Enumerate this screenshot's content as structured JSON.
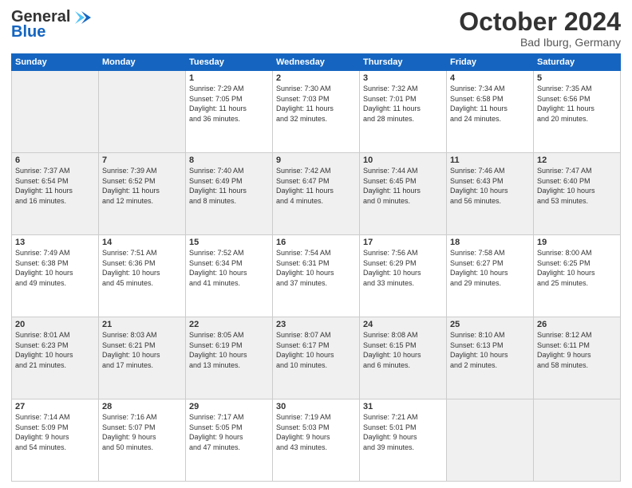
{
  "header": {
    "logo_line1": "General",
    "logo_line2": "Blue",
    "month": "October 2024",
    "location": "Bad Iburg, Germany"
  },
  "days_of_week": [
    "Sunday",
    "Monday",
    "Tuesday",
    "Wednesday",
    "Thursday",
    "Friday",
    "Saturday"
  ],
  "weeks": [
    [
      {
        "day": "",
        "info": ""
      },
      {
        "day": "",
        "info": ""
      },
      {
        "day": "1",
        "info": "Sunrise: 7:29 AM\nSunset: 7:05 PM\nDaylight: 11 hours\nand 36 minutes."
      },
      {
        "day": "2",
        "info": "Sunrise: 7:30 AM\nSunset: 7:03 PM\nDaylight: 11 hours\nand 32 minutes."
      },
      {
        "day": "3",
        "info": "Sunrise: 7:32 AM\nSunset: 7:01 PM\nDaylight: 11 hours\nand 28 minutes."
      },
      {
        "day": "4",
        "info": "Sunrise: 7:34 AM\nSunset: 6:58 PM\nDaylight: 11 hours\nand 24 minutes."
      },
      {
        "day": "5",
        "info": "Sunrise: 7:35 AM\nSunset: 6:56 PM\nDaylight: 11 hours\nand 20 minutes."
      }
    ],
    [
      {
        "day": "6",
        "info": "Sunrise: 7:37 AM\nSunset: 6:54 PM\nDaylight: 11 hours\nand 16 minutes."
      },
      {
        "day": "7",
        "info": "Sunrise: 7:39 AM\nSunset: 6:52 PM\nDaylight: 11 hours\nand 12 minutes."
      },
      {
        "day": "8",
        "info": "Sunrise: 7:40 AM\nSunset: 6:49 PM\nDaylight: 11 hours\nand 8 minutes."
      },
      {
        "day": "9",
        "info": "Sunrise: 7:42 AM\nSunset: 6:47 PM\nDaylight: 11 hours\nand 4 minutes."
      },
      {
        "day": "10",
        "info": "Sunrise: 7:44 AM\nSunset: 6:45 PM\nDaylight: 11 hours\nand 0 minutes."
      },
      {
        "day": "11",
        "info": "Sunrise: 7:46 AM\nSunset: 6:43 PM\nDaylight: 10 hours\nand 56 minutes."
      },
      {
        "day": "12",
        "info": "Sunrise: 7:47 AM\nSunset: 6:40 PM\nDaylight: 10 hours\nand 53 minutes."
      }
    ],
    [
      {
        "day": "13",
        "info": "Sunrise: 7:49 AM\nSunset: 6:38 PM\nDaylight: 10 hours\nand 49 minutes."
      },
      {
        "day": "14",
        "info": "Sunrise: 7:51 AM\nSunset: 6:36 PM\nDaylight: 10 hours\nand 45 minutes."
      },
      {
        "day": "15",
        "info": "Sunrise: 7:52 AM\nSunset: 6:34 PM\nDaylight: 10 hours\nand 41 minutes."
      },
      {
        "day": "16",
        "info": "Sunrise: 7:54 AM\nSunset: 6:31 PM\nDaylight: 10 hours\nand 37 minutes."
      },
      {
        "day": "17",
        "info": "Sunrise: 7:56 AM\nSunset: 6:29 PM\nDaylight: 10 hours\nand 33 minutes."
      },
      {
        "day": "18",
        "info": "Sunrise: 7:58 AM\nSunset: 6:27 PM\nDaylight: 10 hours\nand 29 minutes."
      },
      {
        "day": "19",
        "info": "Sunrise: 8:00 AM\nSunset: 6:25 PM\nDaylight: 10 hours\nand 25 minutes."
      }
    ],
    [
      {
        "day": "20",
        "info": "Sunrise: 8:01 AM\nSunset: 6:23 PM\nDaylight: 10 hours\nand 21 minutes."
      },
      {
        "day": "21",
        "info": "Sunrise: 8:03 AM\nSunset: 6:21 PM\nDaylight: 10 hours\nand 17 minutes."
      },
      {
        "day": "22",
        "info": "Sunrise: 8:05 AM\nSunset: 6:19 PM\nDaylight: 10 hours\nand 13 minutes."
      },
      {
        "day": "23",
        "info": "Sunrise: 8:07 AM\nSunset: 6:17 PM\nDaylight: 10 hours\nand 10 minutes."
      },
      {
        "day": "24",
        "info": "Sunrise: 8:08 AM\nSunset: 6:15 PM\nDaylight: 10 hours\nand 6 minutes."
      },
      {
        "day": "25",
        "info": "Sunrise: 8:10 AM\nSunset: 6:13 PM\nDaylight: 10 hours\nand 2 minutes."
      },
      {
        "day": "26",
        "info": "Sunrise: 8:12 AM\nSunset: 6:11 PM\nDaylight: 9 hours\nand 58 minutes."
      }
    ],
    [
      {
        "day": "27",
        "info": "Sunrise: 7:14 AM\nSunset: 5:09 PM\nDaylight: 9 hours\nand 54 minutes."
      },
      {
        "day": "28",
        "info": "Sunrise: 7:16 AM\nSunset: 5:07 PM\nDaylight: 9 hours\nand 50 minutes."
      },
      {
        "day": "29",
        "info": "Sunrise: 7:17 AM\nSunset: 5:05 PM\nDaylight: 9 hours\nand 47 minutes."
      },
      {
        "day": "30",
        "info": "Sunrise: 7:19 AM\nSunset: 5:03 PM\nDaylight: 9 hours\nand 43 minutes."
      },
      {
        "day": "31",
        "info": "Sunrise: 7:21 AM\nSunset: 5:01 PM\nDaylight: 9 hours\nand 39 minutes."
      },
      {
        "day": "",
        "info": ""
      },
      {
        "day": "",
        "info": ""
      }
    ]
  ]
}
